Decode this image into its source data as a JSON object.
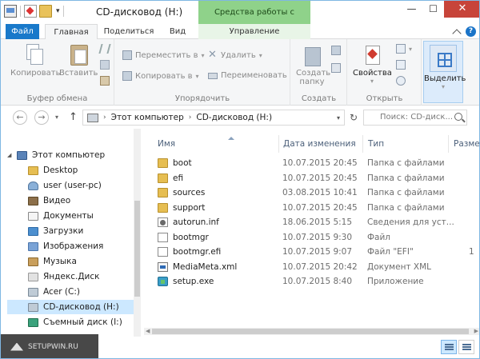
{
  "window": {
    "title": "CD-дисковод (H:)",
    "context_tab_header": "Средства работы с дисками",
    "controls": {
      "minimize": "—",
      "maximize": "☐",
      "close": "✕"
    }
  },
  "tabs": {
    "file": "Файл",
    "home": "Главная",
    "share": "Поделиться",
    "view": "Вид",
    "manage": "Управление"
  },
  "ribbon": {
    "clipboard": {
      "label": "Буфер обмена",
      "copy": "Копировать",
      "paste": "Вставить"
    },
    "organize": {
      "label": "Упорядочить",
      "move_to": "Переместить в",
      "copy_to": "Копировать в",
      "delete": "Удалить",
      "rename": "Переименовать"
    },
    "new": {
      "label": "Создать",
      "new_folder_line1": "Создать",
      "new_folder_line2": "папку"
    },
    "open": {
      "label": "Открыть",
      "properties": "Свойства"
    },
    "select": {
      "label": "Выделить"
    }
  },
  "address": {
    "segments": [
      "Этот компьютер",
      "CD-дисковод (H:)"
    ],
    "search_placeholder": "Поиск: CD-диск..."
  },
  "nav": {
    "items": [
      {
        "label": "Этот компьютер",
        "icon": "computer-icon"
      },
      {
        "label": "Desktop",
        "icon": "folder-icon"
      },
      {
        "label": "user (user-pc)",
        "icon": "user-folder-icon"
      },
      {
        "label": "Видео",
        "icon": "video-folder-icon"
      },
      {
        "label": "Документы",
        "icon": "documents-folder-icon"
      },
      {
        "label": "Загрузки",
        "icon": "downloads-folder-icon"
      },
      {
        "label": "Изображения",
        "icon": "pictures-folder-icon"
      },
      {
        "label": "Музыка",
        "icon": "music-folder-icon"
      },
      {
        "label": "Яндекс.Диск",
        "icon": "yandex-disk-icon"
      },
      {
        "label": "Acer (C:)",
        "icon": "hard-drive-icon"
      },
      {
        "label": "CD-дисковод (H:)",
        "icon": "cd-drive-icon"
      },
      {
        "label": "Съемный диск (I:)",
        "icon": "usb-drive-icon"
      }
    ]
  },
  "filelist": {
    "columns": {
      "name": "Имя",
      "date": "Дата изменения",
      "type": "Тип",
      "size": "Разме"
    },
    "rows": [
      {
        "name": "boot",
        "date": "10.07.2015 20:45",
        "type": "Папка с файлами",
        "size": "",
        "icon": "folder-icon"
      },
      {
        "name": "efi",
        "date": "10.07.2015 20:45",
        "type": "Папка с файлами",
        "size": "",
        "icon": "folder-icon"
      },
      {
        "name": "sources",
        "date": "03.08.2015 10:41",
        "type": "Папка с файлами",
        "size": "",
        "icon": "folder-icon"
      },
      {
        "name": "support",
        "date": "10.07.2015 20:45",
        "type": "Папка с файлами",
        "size": "",
        "icon": "folder-icon"
      },
      {
        "name": "autorun.inf",
        "date": "18.06.2015 5:15",
        "type": "Сведения для уст...",
        "size": "",
        "icon": "setup-info-icon"
      },
      {
        "name": "bootmgr",
        "date": "10.07.2015 9:30",
        "type": "Файл",
        "size": "",
        "icon": "file-icon"
      },
      {
        "name": "bootmgr.efi",
        "date": "10.07.2015 9:07",
        "type": "Файл \"EFI\"",
        "size": "1",
        "icon": "file-icon"
      },
      {
        "name": "MediaMeta.xml",
        "date": "10.07.2015 20:42",
        "type": "Документ XML",
        "size": "",
        "icon": "xml-file-icon"
      },
      {
        "name": "setup.exe",
        "date": "10.07.2015 8:40",
        "type": "Приложение",
        "size": "",
        "icon": "setup-exe-icon"
      }
    ]
  },
  "watermark": {
    "text": "SETUPWIN.RU"
  },
  "colors": {
    "file_tab": "#1979ca",
    "context_tab": "#8fd28a",
    "close_button": "#c7443a",
    "selection": "#cce8ff",
    "folder": "#e6be52"
  }
}
